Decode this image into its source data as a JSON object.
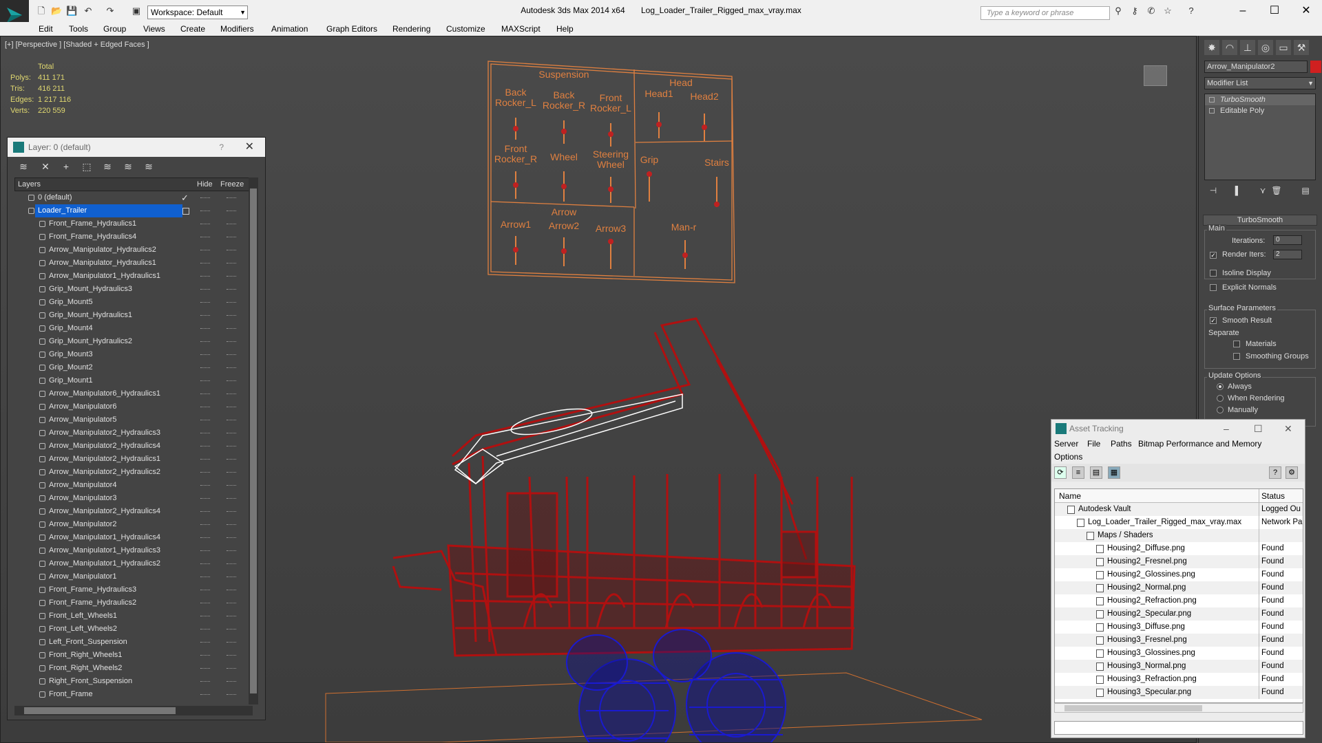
{
  "titlebar": {
    "workspace": "Workspace: Default",
    "app": "Autodesk 3ds Max  2014 x64",
    "file": "Log_Loader_Trailer_Rigged_max_vray.max",
    "search_placeholder": "Type a keyword or phrase"
  },
  "menu": [
    "Edit",
    "Tools",
    "Group",
    "Views",
    "Create",
    "Modifiers",
    "Animation",
    "Graph Editors",
    "Rendering",
    "Customize",
    "MAXScript",
    "Help"
  ],
  "viewport": {
    "label": "[+] [Perspective ] [Shaded + Edged Faces ]",
    "stats": {
      "header": "Total",
      "rows": [
        {
          "k": "Polys:",
          "v": "411 171"
        },
        {
          "k": "Tris:",
          "v": "416 211"
        },
        {
          "k": "Edges:",
          "v": "1 217 116"
        },
        {
          "k": "Verts:",
          "v": "220 559"
        }
      ]
    },
    "rig_panel": {
      "suspension": "Suspension",
      "head": "Head",
      "labels": [
        "Back\nRocker_L",
        "Back\nRocker_R",
        "Front\nRocker_L",
        "Head1",
        "Head2",
        "Front\nRocker_R",
        "Wheel",
        "Steering\nWheel",
        "Grip",
        "Stairs",
        "Arrow",
        "Arrow1",
        "Arrow2",
        "Arrow3",
        "Man-r"
      ]
    },
    "colors": {
      "wire_red": "#b01010",
      "wire_blue": "#1a1ad0",
      "rig_orange": "#e08040"
    }
  },
  "layer_panel": {
    "title": "Layer: 0 (default)",
    "help": "?",
    "col_layers": "Layers",
    "col_hide": "Hide",
    "col_freeze": "Freeze",
    "top_items": [
      "0 (default)",
      "Loader_Trailer"
    ],
    "items": [
      "Front_Frame_Hydraulics1",
      "Front_Frame_Hydraulics4",
      "Arrow_Manipulator_Hydraulics2",
      "Arrow_Manipulator_Hydraulics1",
      "Arrow_Manipulator1_Hydraulics1",
      "Grip_Mount_Hydraulics3",
      "Grip_Mount5",
      "Grip_Mount_Hydraulics1",
      "Grip_Mount4",
      "Grip_Mount_Hydraulics2",
      "Grip_Mount3",
      "Grip_Mount2",
      "Grip_Mount1",
      "Arrow_Manipulator6_Hydraulics1",
      "Arrow_Manipulator6",
      "Arrow_Manipulator5",
      "Arrow_Manipulator2_Hydraulics3",
      "Arrow_Manipulator2_Hydraulics4",
      "Arrow_Manipulator2_Hydraulics1",
      "Arrow_Manipulator2_Hydraulics2",
      "Arrow_Manipulator4",
      "Arrow_Manipulator3",
      "Arrow_Manipulator2_Hydraulics4",
      "Arrow_Manipulator2",
      "Arrow_Manipulator1_Hydraulics4",
      "Arrow_Manipulator1_Hydraulics3",
      "Arrow_Manipulator1_Hydraulics2",
      "Arrow_Manipulator1",
      "Front_Frame_Hydraulics3",
      "Front_Frame_Hydraulics2",
      "Front_Left_Wheels1",
      "Front_Left_Wheels2",
      "Left_Front_Suspension",
      "Front_Right_Wheels1",
      "Front_Right_Wheels2",
      "Right_Front_Suspension",
      "Front_Frame"
    ]
  },
  "command_panel": {
    "object_name": "Arrow_Manipulator2",
    "object_color": "#d02020",
    "modifier_list": "Modifier List",
    "stack": [
      "TurboSmooth",
      "Editable Poly"
    ],
    "rollout_title": "TurboSmooth",
    "main_label": "Main",
    "iterations_label": "Iterations:",
    "iterations_value": "0",
    "render_iters_label": "Render Iters:",
    "render_iters_value": "2",
    "isoline": "Isoline Display",
    "explicit_normals": "Explicit Normals",
    "surface_params": "Surface Parameters",
    "smooth_result": "Smooth Result",
    "separate": "Separate",
    "materials": "Materials",
    "smoothing_groups": "Smoothing Groups",
    "update_options": "Update Options",
    "always": "Always",
    "when_rendering": "When Rendering",
    "manually": "Manually"
  },
  "asset_tracking": {
    "title": "Asset Tracking",
    "menu": [
      "Server",
      "File",
      "Paths",
      "Bitmap Performance and Memory",
      "Options"
    ],
    "col_name": "Name",
    "col_status": "Status",
    "rows": [
      {
        "name": "Autodesk Vault",
        "status": "Logged Ou",
        "indent": 1
      },
      {
        "name": "Log_Loader_Trailer_Rigged_max_vray.max",
        "status": "Network Pa",
        "indent": 2
      },
      {
        "name": "Maps / Shaders",
        "status": "",
        "indent": 3
      },
      {
        "name": "Housing2_Diffuse.png",
        "status": "Found",
        "indent": 4
      },
      {
        "name": "Housing2_Fresnel.png",
        "status": "Found",
        "indent": 4
      },
      {
        "name": "Housing2_Glossines.png",
        "status": "Found",
        "indent": 4
      },
      {
        "name": "Housing2_Normal.png",
        "status": "Found",
        "indent": 4
      },
      {
        "name": "Housing2_Refraction.png",
        "status": "Found",
        "indent": 4
      },
      {
        "name": "Housing2_Specular.png",
        "status": "Found",
        "indent": 4
      },
      {
        "name": "Housing3_Diffuse.png",
        "status": "Found",
        "indent": 4
      },
      {
        "name": "Housing3_Fresnel.png",
        "status": "Found",
        "indent": 4
      },
      {
        "name": "Housing3_Glossines.png",
        "status": "Found",
        "indent": 4
      },
      {
        "name": "Housing3_Normal.png",
        "status": "Found",
        "indent": 4
      },
      {
        "name": "Housing3_Refraction.png",
        "status": "Found",
        "indent": 4
      },
      {
        "name": "Housing3_Specular.png",
        "status": "Found",
        "indent": 4
      }
    ]
  }
}
